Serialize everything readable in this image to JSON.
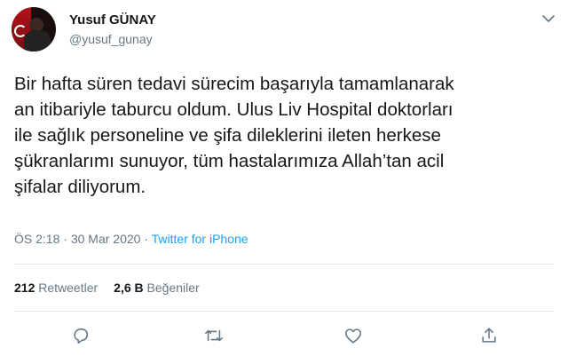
{
  "user": {
    "name": "Yusuf GÜNAY",
    "handle": "@yusuf_gunay"
  },
  "tweet": {
    "lines": [
      "Bir hafta süren tedavi sürecim başarıyla tamamlanarak",
      "an itibariyle taburcu oldum. Ulus Liv Hospital doktorları",
      "ile sağlık personeline ve şifa dileklerini ileten herkese",
      "şükranlarımı sunuyor, tüm hastalarımıza Allah’tan acil",
      "şifalar diliyorum."
    ],
    "time": "ÖS 2:18",
    "date": "30 Mar 2020",
    "separator": "·",
    "source": "Twitter for iPhone"
  },
  "stats": {
    "retweets_count": "212",
    "retweets_label": "Retweetler",
    "likes_count": "2,6 B",
    "likes_label": "Beğeniler"
  },
  "colors": {
    "text": "#14171a",
    "muted": "#657786",
    "link": "#1da1f2",
    "divider": "#e1e8ed"
  },
  "icons": {
    "more": "chevron-down-icon",
    "reply": "reply-icon",
    "retweet": "retweet-icon",
    "like": "heart-icon",
    "share": "share-icon"
  }
}
